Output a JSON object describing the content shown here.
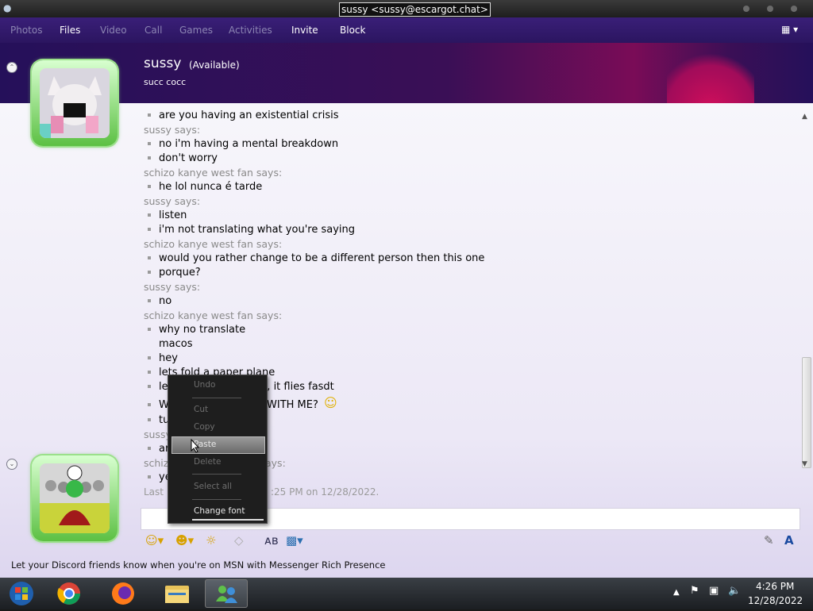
{
  "window": {
    "title": "sussy <sussy@escargot.chat>"
  },
  "menu": {
    "items": [
      {
        "label": "Photos",
        "enabled": false
      },
      {
        "label": "Files",
        "enabled": true
      },
      {
        "label": "Video",
        "enabled": false
      },
      {
        "label": "Call",
        "enabled": false
      },
      {
        "label": "Games",
        "enabled": false
      },
      {
        "label": "Activities",
        "enabled": false
      },
      {
        "label": "Invite",
        "enabled": true
      },
      {
        "label": "Block",
        "enabled": true
      }
    ],
    "right_icon": "menu-options-icon"
  },
  "contact": {
    "name": "sussy",
    "status": "(Available)",
    "personal_message": "succ cocc"
  },
  "conversation": [
    {
      "type": "line",
      "text": "are you having an existential crisis"
    },
    {
      "type": "speaker",
      "text": "sussy says:"
    },
    {
      "type": "line",
      "text": "no i'm having a mental breakdown"
    },
    {
      "type": "line",
      "text": "don't worry"
    },
    {
      "type": "speaker",
      "text": "schizo kanye west fan says:"
    },
    {
      "type": "line",
      "text": "he lol nunca é tarde"
    },
    {
      "type": "speaker",
      "text": "sussy says:"
    },
    {
      "type": "line",
      "text": "listen"
    },
    {
      "type": "line",
      "text": "i'm not translating what you're saying"
    },
    {
      "type": "speaker",
      "text": "schizo kanye west fan says:"
    },
    {
      "type": "line",
      "text": "would you rather change to be a different person then this one"
    },
    {
      "type": "line",
      "text": "porque?"
    },
    {
      "type": "speaker",
      "text": "sussy says:"
    },
    {
      "type": "line",
      "text": "no"
    },
    {
      "type": "speaker",
      "text": "schizo kanye west fan says:"
    },
    {
      "type": "line",
      "text": "why no translate"
    },
    {
      "type": "plain",
      "text": "macos"
    },
    {
      "type": "line",
      "text": "hey"
    },
    {
      "type": "line",
      "text": "lets fold a paper plane"
    },
    {
      "type": "line",
      "text": "le",
      "tail": "ant, it flies fasdt"
    },
    {
      "type": "line",
      "text": "W",
      "tail": "WITH ME?"
    },
    {
      "type": "line",
      "text": "tu"
    },
    {
      "type": "speaker",
      "text": "sussy"
    },
    {
      "type": "line",
      "text": "ar"
    },
    {
      "type": "speaker",
      "text": "schiz",
      "tail": "ays:"
    },
    {
      "type": "line",
      "text": "ye"
    }
  ],
  "last_message": {
    "prefix": "Last",
    "suffix": ":25 PM on 12/28/2022."
  },
  "context_menu": {
    "items": [
      {
        "label": "Undo",
        "enabled": false
      },
      {
        "label": "Cut",
        "enabled": false
      },
      {
        "label": "Copy",
        "enabled": false
      },
      {
        "label": "Paste",
        "enabled": true,
        "highlighted": true
      },
      {
        "label": "Delete",
        "enabled": false
      },
      {
        "label": "Select all",
        "enabled": false
      },
      {
        "label": "Change font",
        "enabled": true
      }
    ]
  },
  "promo": {
    "text": "Let your Discord friends know when you're on MSN with Messenger Rich Presence"
  },
  "taskbar": {
    "apps": [
      "start-orb-icon",
      "chrome-icon",
      "firefox-icon",
      "file-explorer-icon",
      "messenger-icon"
    ],
    "time": "4:26 PM",
    "date": "12/28/2022"
  },
  "colors": {
    "menubar": "#2b1560",
    "header_accent": "#d00e5b",
    "avatar_frame": "#5cc043"
  }
}
